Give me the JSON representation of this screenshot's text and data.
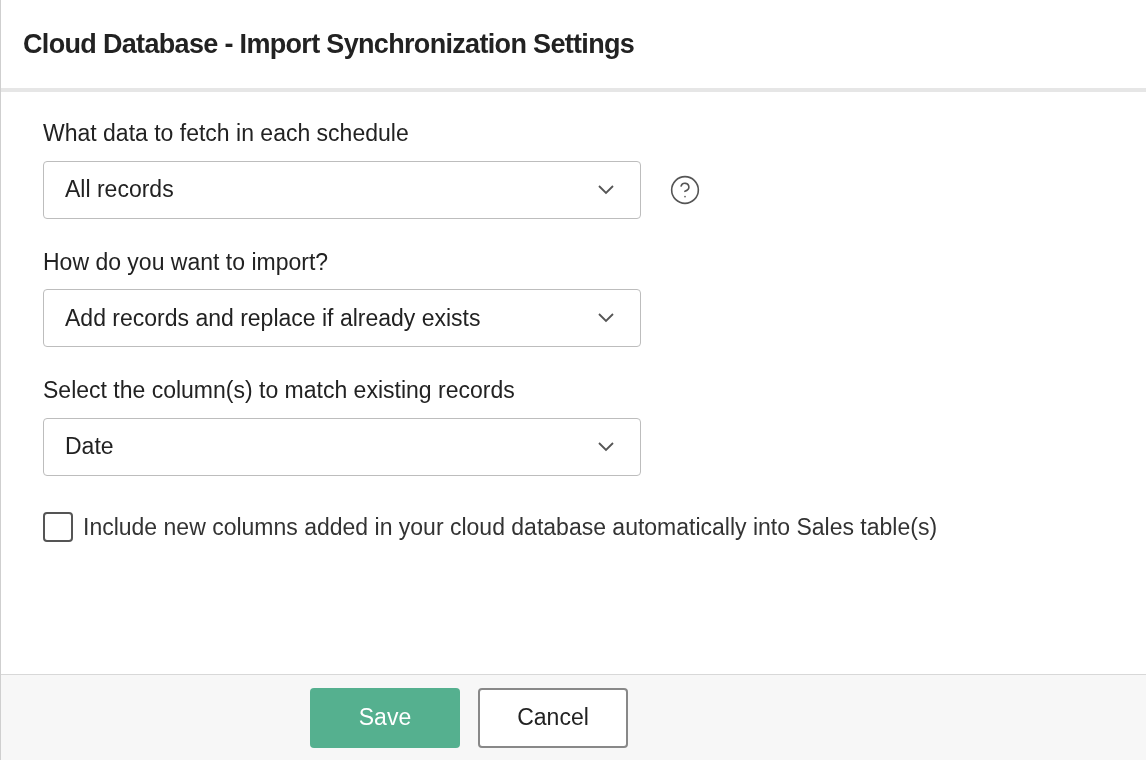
{
  "dialog": {
    "title": "Cloud Database - Import Synchronization Settings"
  },
  "fields": [
    {
      "label": "What data to fetch in each schedule",
      "value": "All records",
      "help": true
    },
    {
      "label": "How do you want to import?",
      "value": "Add records and replace if already exists",
      "help": false
    },
    {
      "label": "Select the column(s) to match existing records",
      "value": "Date",
      "help": false
    }
  ],
  "option": {
    "label": "Include new columns added in your cloud database automatically into Sales table(s)",
    "checked": false
  },
  "buttons": [
    {
      "label": "Save",
      "kind": "primary"
    },
    {
      "label": "Cancel",
      "kind": "secondary"
    }
  ]
}
